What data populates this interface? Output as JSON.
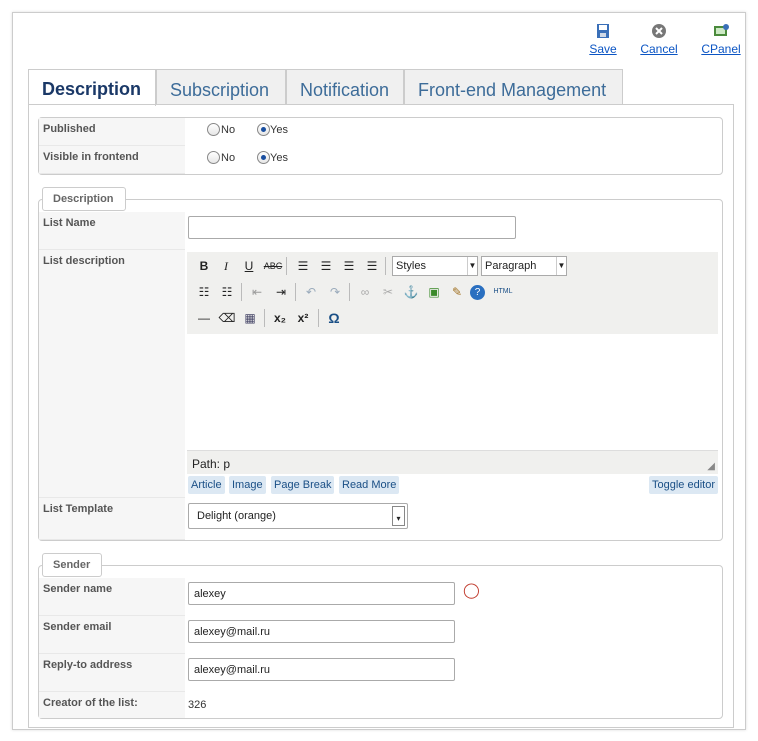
{
  "toolbar": {
    "save": "Save",
    "cancel": "Cancel",
    "cpanel": "CPanel"
  },
  "tabs": [
    {
      "label": "Description",
      "active": true
    },
    {
      "label": "Subscription",
      "active": false
    },
    {
      "label": "Notification",
      "active": false
    },
    {
      "label": "Front-end Management",
      "active": false
    }
  ],
  "publish": {
    "published_label": "Published",
    "visible_label": "Visible in frontend",
    "no": "No",
    "yes": "Yes",
    "published_value": "Yes",
    "visible_value": "Yes"
  },
  "description": {
    "legend": "Description",
    "list_name_label": "List Name",
    "list_name_value": "",
    "list_desc_label": "List description",
    "styles": "Styles",
    "paragraph": "Paragraph",
    "path": "Path: p",
    "buttons": [
      "Article",
      "Image",
      "Page Break",
      "Read More"
    ],
    "toggle": "Toggle editor",
    "template_label": "List Template",
    "template_value": "Delight (orange)"
  },
  "sender": {
    "legend": "Sender",
    "name_label": "Sender name",
    "name_value": "alexey",
    "email_label": "Sender email",
    "email_value": "alexey@mail.ru",
    "reply_label": "Reply-to address",
    "reply_value": "alexey@mail.ru",
    "creator_label": "Creator of the list:",
    "creator_value": "326"
  },
  "colors": {
    "accent": "#0b55c4",
    "tab_active": "#1a3867",
    "tab_text": "#3d6c99"
  }
}
